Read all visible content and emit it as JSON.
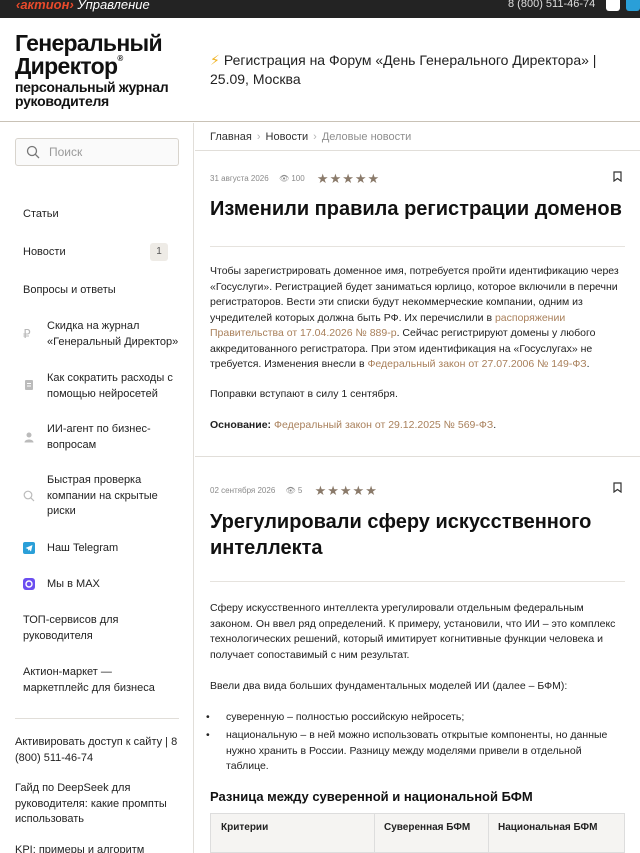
{
  "topbar": {
    "brand_main": "‹актион›",
    "brand_sub": "Управление",
    "phone": "8 (800) 511-46-74"
  },
  "header": {
    "logo_line1": "Генеральный",
    "logo_line2": "Директор",
    "logo_reg": "®",
    "logo_tag1": "персональный журнал",
    "logo_tag2": "руководителя",
    "promo": "Регистрация на Форум «День Генерального Директора» | 25.09, Москва"
  },
  "sidebar": {
    "search_placeholder": "Поиск",
    "items": [
      {
        "label": "Статьи"
      },
      {
        "label": "Новости",
        "badge": "1"
      },
      {
        "label": "Вопросы и ответы"
      },
      {
        "label": "Скидка на журнал «Генеральный Директор»",
        "icon": "ruble-icon"
      },
      {
        "label": "Как сократить расходы с помощью нейросетей",
        "icon": "document-icon"
      },
      {
        "label": "ИИ-агент по бизнес-вопросам",
        "icon": "person-icon"
      },
      {
        "label": "Быстрая проверка компании на скрытые риски",
        "icon": "search-icon"
      },
      {
        "label": "Наш Telegram",
        "icon": "telegram-icon"
      },
      {
        "label": "Мы в MAX",
        "icon": "max-icon"
      },
      {
        "label": "ТОП-сервисов для руководителя"
      },
      {
        "label": "Актион-маркет — маркетплейс для бизнеса"
      }
    ],
    "links": [
      "Активировать доступ к сайту | 8 (800) 511-46-74",
      "Гайд по DeepSeek для руководителя: какие промпты использовать",
      "KPI: примеры и алгоритм"
    ]
  },
  "breadcrumb": {
    "home": "Главная",
    "news": "Новости",
    "current": "Деловые новости"
  },
  "articles": [
    {
      "date": "31 августа 2026",
      "views": "100",
      "title": "Изменили правила регистрации доменов",
      "p1_a": "Чтобы зарегистрировать доменное имя, потребуется пройти идентификацию через «Госуслуги». Регистрацией будет заниматься юрлицо, которое включили в перечни регистраторов. Вести эти списки будут некоммерческие компании, одним из учредителей которых должна быть РФ. Их перечислили в ",
      "p1_link1": "распоряжении Правительства от 17.04.2026 № 889-р",
      "p1_b": ". Сейчас регистрируют домены у любого аккредитованного регистратора. При этом идентификация на «Госуслугах» не требуется. Изменения внесли в ",
      "p1_link2": "Федеральный закон от 27.07.2006 № 149-ФЗ",
      "p1_c": ".",
      "p2": "Поправки вступают в силу 1 сентября.",
      "basis_label": "Основание:",
      "basis_link": "Федеральный закон от 29.12.2025 № 569-ФЗ",
      "basis_end": "."
    },
    {
      "date": "02 сентября 2026",
      "views": "5",
      "title": "Урегулировали сферу искусственного интеллекта",
      "p1": "Сферу искусственного интеллекта урегулировали отдельным федеральным законом. Он ввел ряд определений. К примеру, установили, что ИИ – это комплекс технологических решений, который имитирует когнитивные функции человека и получает сопоставимый с ним результат.",
      "p2": "Ввели два вида больших фундаментальных моделей ИИ (далее – БФМ):",
      "bullets": [
        "суверенную – полностью российскую нейросеть;",
        "национальную – в ней можно использовать открытые компоненты, но данные нужно хранить в России. Разницу между моделями привели в отдельной таблице."
      ],
      "subheading": "Разница между суверенной и национальной БФМ",
      "table_headers": [
        "Критерии",
        "Суверенная БФМ",
        "Национальная БФМ"
      ]
    }
  ],
  "colors": {
    "accent": "#e84a2b",
    "link": "#a9805b",
    "topbar": "#232323"
  }
}
